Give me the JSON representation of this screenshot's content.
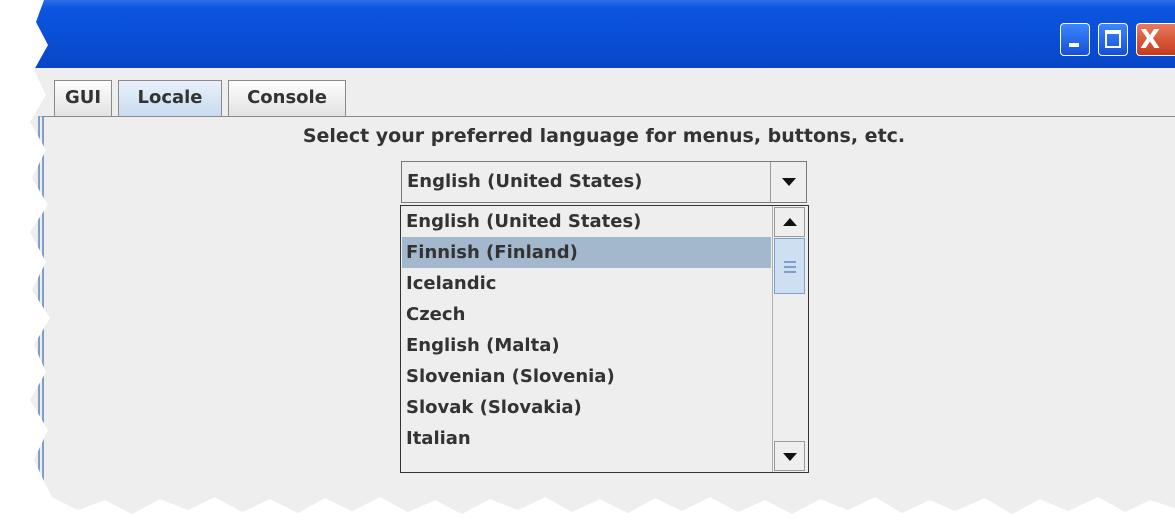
{
  "window": {
    "title": "",
    "controls": [
      "minimize-icon",
      "maximize-icon",
      "close-icon"
    ],
    "close_glyph": "X",
    "accent_color": "#0a4ed6"
  },
  "tabs": [
    {
      "label": "GUI",
      "selected": false
    },
    {
      "label": "Locale",
      "selected": true
    },
    {
      "label": "Console",
      "selected": false
    }
  ],
  "locale_panel": {
    "heading": "Select your preferred language for menus, buttons, etc.",
    "language_combo": {
      "value": "English (United States)",
      "open": true
    },
    "options": [
      "English (United States)",
      "Finnish (Finland)",
      "Icelandic",
      "Czech",
      "English (Malta)",
      "Slovenian (Slovenia)",
      "Slovak (Slovakia)",
      "Italian"
    ],
    "highlighted_option": "Finnish (Finland)",
    "selection_color": "#a3b8cc"
  }
}
